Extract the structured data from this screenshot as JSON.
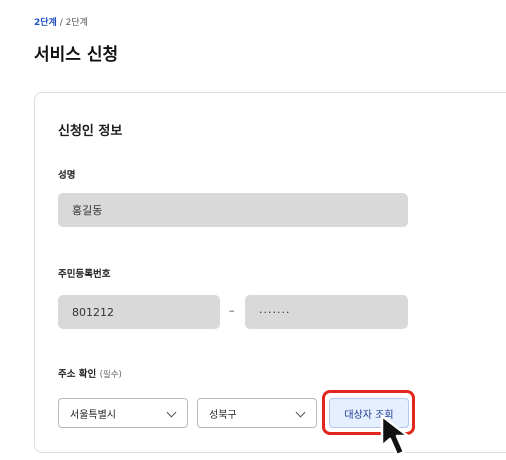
{
  "breadcrumb": {
    "current": "2단계",
    "separator": "/",
    "total": "2단계"
  },
  "page_title": "서비스 신청",
  "section_title": "신청인 정보",
  "name": {
    "label": "성명",
    "value": "홍길동"
  },
  "resident_number": {
    "label": "주민등록번호",
    "front": "801212",
    "dash": "–",
    "back": "·······"
  },
  "address": {
    "label": "주소 확인",
    "optional": "(필수)",
    "city": "서울특별시",
    "district": "성북구",
    "lookup_button": "대상자 조회"
  },
  "colors": {
    "accent": "#1f4fbf",
    "highlight": "#e3271c"
  },
  "icons": {
    "select_arrow": "chevron-down-icon",
    "cursor": "mouse-pointer-icon"
  }
}
